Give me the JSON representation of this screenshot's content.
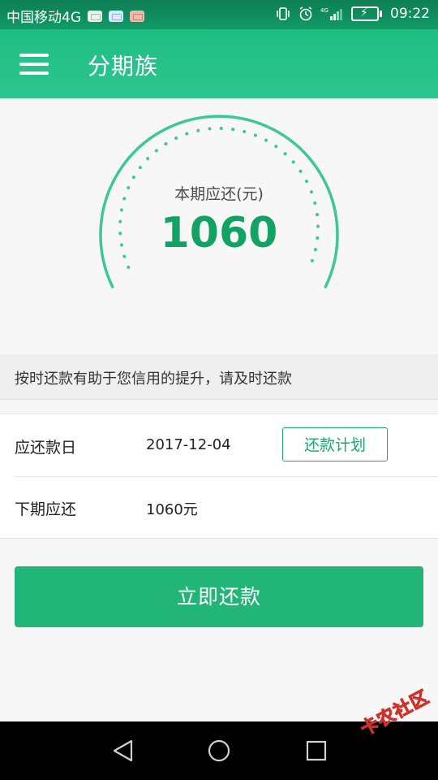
{
  "status_bar": {
    "carrier": "中国移动4G",
    "network_badge": "4G",
    "time": "09:22"
  },
  "app_bar": {
    "title": "分期族",
    "menu_icon": "hamburger-menu-icon"
  },
  "gauge": {
    "label": "本期应还(元)",
    "value": "1060",
    "arc_color": "#3cc79a"
  },
  "notice": {
    "text": "按时还款有助于您信用的提升，请及时还款"
  },
  "info": {
    "due_date_label": "应还款日",
    "due_date_value": "2017-12-04",
    "plan_button": "还款计划",
    "next_label": "下期应还",
    "next_value": "1060元"
  },
  "actions": {
    "repay_button": "立即还款"
  },
  "watermark": {
    "text": "卡农社区"
  },
  "colors": {
    "primary": "#21b578",
    "accent_text": "#12a263",
    "header_dark": "#0e7e55"
  }
}
